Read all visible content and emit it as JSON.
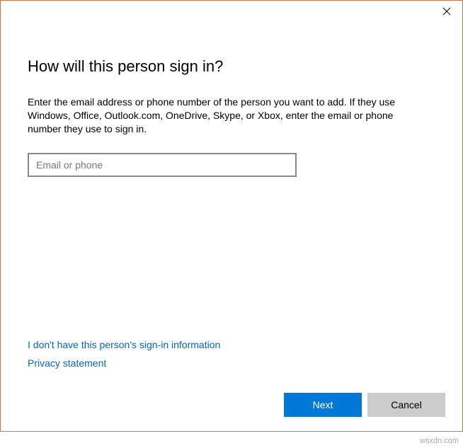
{
  "dialog": {
    "title": "How will this person sign in?",
    "description": "Enter the email address or phone number of the person you want to add. If they use Windows, Office, Outlook.com, OneDrive, Skype, or Xbox, enter the email or phone number they use to sign in.",
    "input": {
      "placeholder": "Email or phone",
      "value": ""
    },
    "links": {
      "no_info": "I don't have this person's sign-in information",
      "privacy": "Privacy statement"
    },
    "buttons": {
      "next": "Next",
      "cancel": "Cancel"
    }
  },
  "watermark": "wsxdn.com"
}
